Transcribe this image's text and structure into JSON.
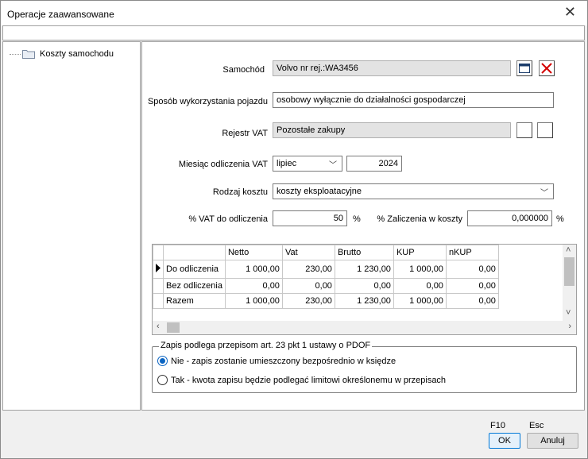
{
  "window": {
    "title": "Operacje zaawansowane"
  },
  "tree": {
    "items": [
      {
        "label": "Koszty samochodu",
        "icon": "folder-icon"
      }
    ]
  },
  "form": {
    "samochod": {
      "label": "Samochód",
      "value": "Volvo nr rej.:WA3456"
    },
    "sposob": {
      "label": "Sposób wykorzystania pojazdu",
      "value": "osobowy wyłącznie do działalności gospodarczej"
    },
    "rejestr": {
      "label": "Rejestr VAT",
      "value": "Pozostałe zakupy"
    },
    "miesiac": {
      "label": "Miesiąc odliczenia VAT",
      "month": "lipiec",
      "year": "2024"
    },
    "rodzaj": {
      "label": "Rodzaj kosztu",
      "value": "koszty eksploatacyjne"
    },
    "vat_pct": {
      "label": "% VAT do odliczenia",
      "value": "50",
      "unit": "%"
    },
    "zal_pct": {
      "label": "% Zaliczenia w koszty",
      "value": "0,000000",
      "unit": "%"
    }
  },
  "grid": {
    "columns": [
      "",
      "Netto",
      "Vat",
      "Brutto",
      "KUP",
      "nKUP"
    ],
    "rows": [
      {
        "label": "Do odliczenia",
        "values": [
          "1 000,00",
          "230,00",
          "1 230,00",
          "1 000,00",
          "0,00"
        ],
        "current": true
      },
      {
        "label": "Bez odliczenia",
        "values": [
          "0,00",
          "0,00",
          "0,00",
          "0,00",
          "0,00"
        ],
        "current": false
      },
      {
        "label": "Razem",
        "values": [
          "1 000,00",
          "230,00",
          "1 230,00",
          "1 000,00",
          "0,00"
        ],
        "current": false
      }
    ]
  },
  "group": {
    "title": "Zapis podlega przepisom art. 23 pkt 1 ustawy o PDOF",
    "options": [
      {
        "label": "Nie - zapis zostanie umieszczony bezpośrednio w księdze",
        "selected": true
      },
      {
        "label": "Tak - kwota zapisu będzie podlegać limitowi określonemu w przepisach",
        "selected": false
      }
    ]
  },
  "footer": {
    "ok_hotkey": "F10",
    "ok_label": "OK",
    "cancel_hotkey": "Esc",
    "cancel_label": "Anuluj"
  },
  "colors": {
    "accent": "#0078d7",
    "delete_red": "#d40000",
    "folder": "#f3d27a"
  }
}
